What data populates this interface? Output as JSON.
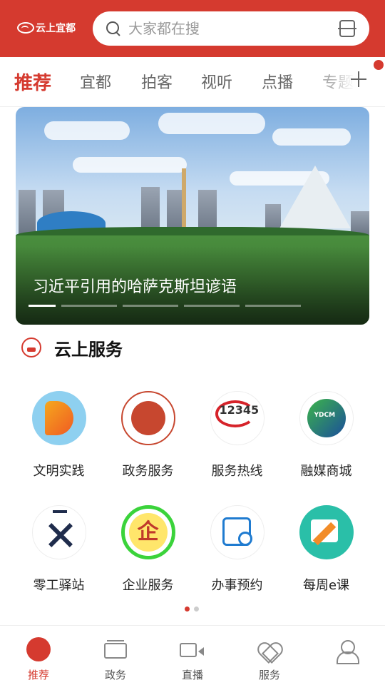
{
  "header": {
    "logo_text": "云上宜都",
    "search_placeholder": "大家都在搜",
    "accent_color": "#d53a2f"
  },
  "tabs": {
    "items": [
      "推荐",
      "宜都",
      "拍客",
      "视听",
      "点播",
      "专题"
    ],
    "active_index": 0
  },
  "banner": {
    "title": "习近平引用的哈萨克斯坦谚语",
    "slide_count": 6,
    "active_slide": 0
  },
  "services": {
    "title": "云上服务",
    "items": [
      {
        "label": "文明实践",
        "icon": "civilization-practice-icon"
      },
      {
        "label": "政务服务",
        "icon": "government-service-icon"
      },
      {
        "label": "服务热线",
        "icon": "hotline-12345-icon"
      },
      {
        "label": "融媒商城",
        "icon": "media-mall-icon"
      },
      {
        "label": "零工驿站",
        "icon": "gig-station-icon"
      },
      {
        "label": "企业服务",
        "icon": "enterprise-service-icon"
      },
      {
        "label": "办事预约",
        "icon": "appointment-calendar-icon"
      },
      {
        "label": "每周e课",
        "icon": "weekly-course-icon"
      }
    ],
    "hotline_badge": "12345",
    "media_badge": "YDCM",
    "enterprise_glyph": "企",
    "page_count": 2,
    "active_page": 0
  },
  "bottom_nav": {
    "items": [
      {
        "label": "推荐",
        "icon": "home-icon"
      },
      {
        "label": "政务",
        "icon": "government-icon"
      },
      {
        "label": "直播",
        "icon": "live-video-icon"
      },
      {
        "label": "服务",
        "icon": "service-heart-icon"
      },
      {
        "label": "",
        "icon": "profile-icon"
      }
    ],
    "active_index": 0
  }
}
